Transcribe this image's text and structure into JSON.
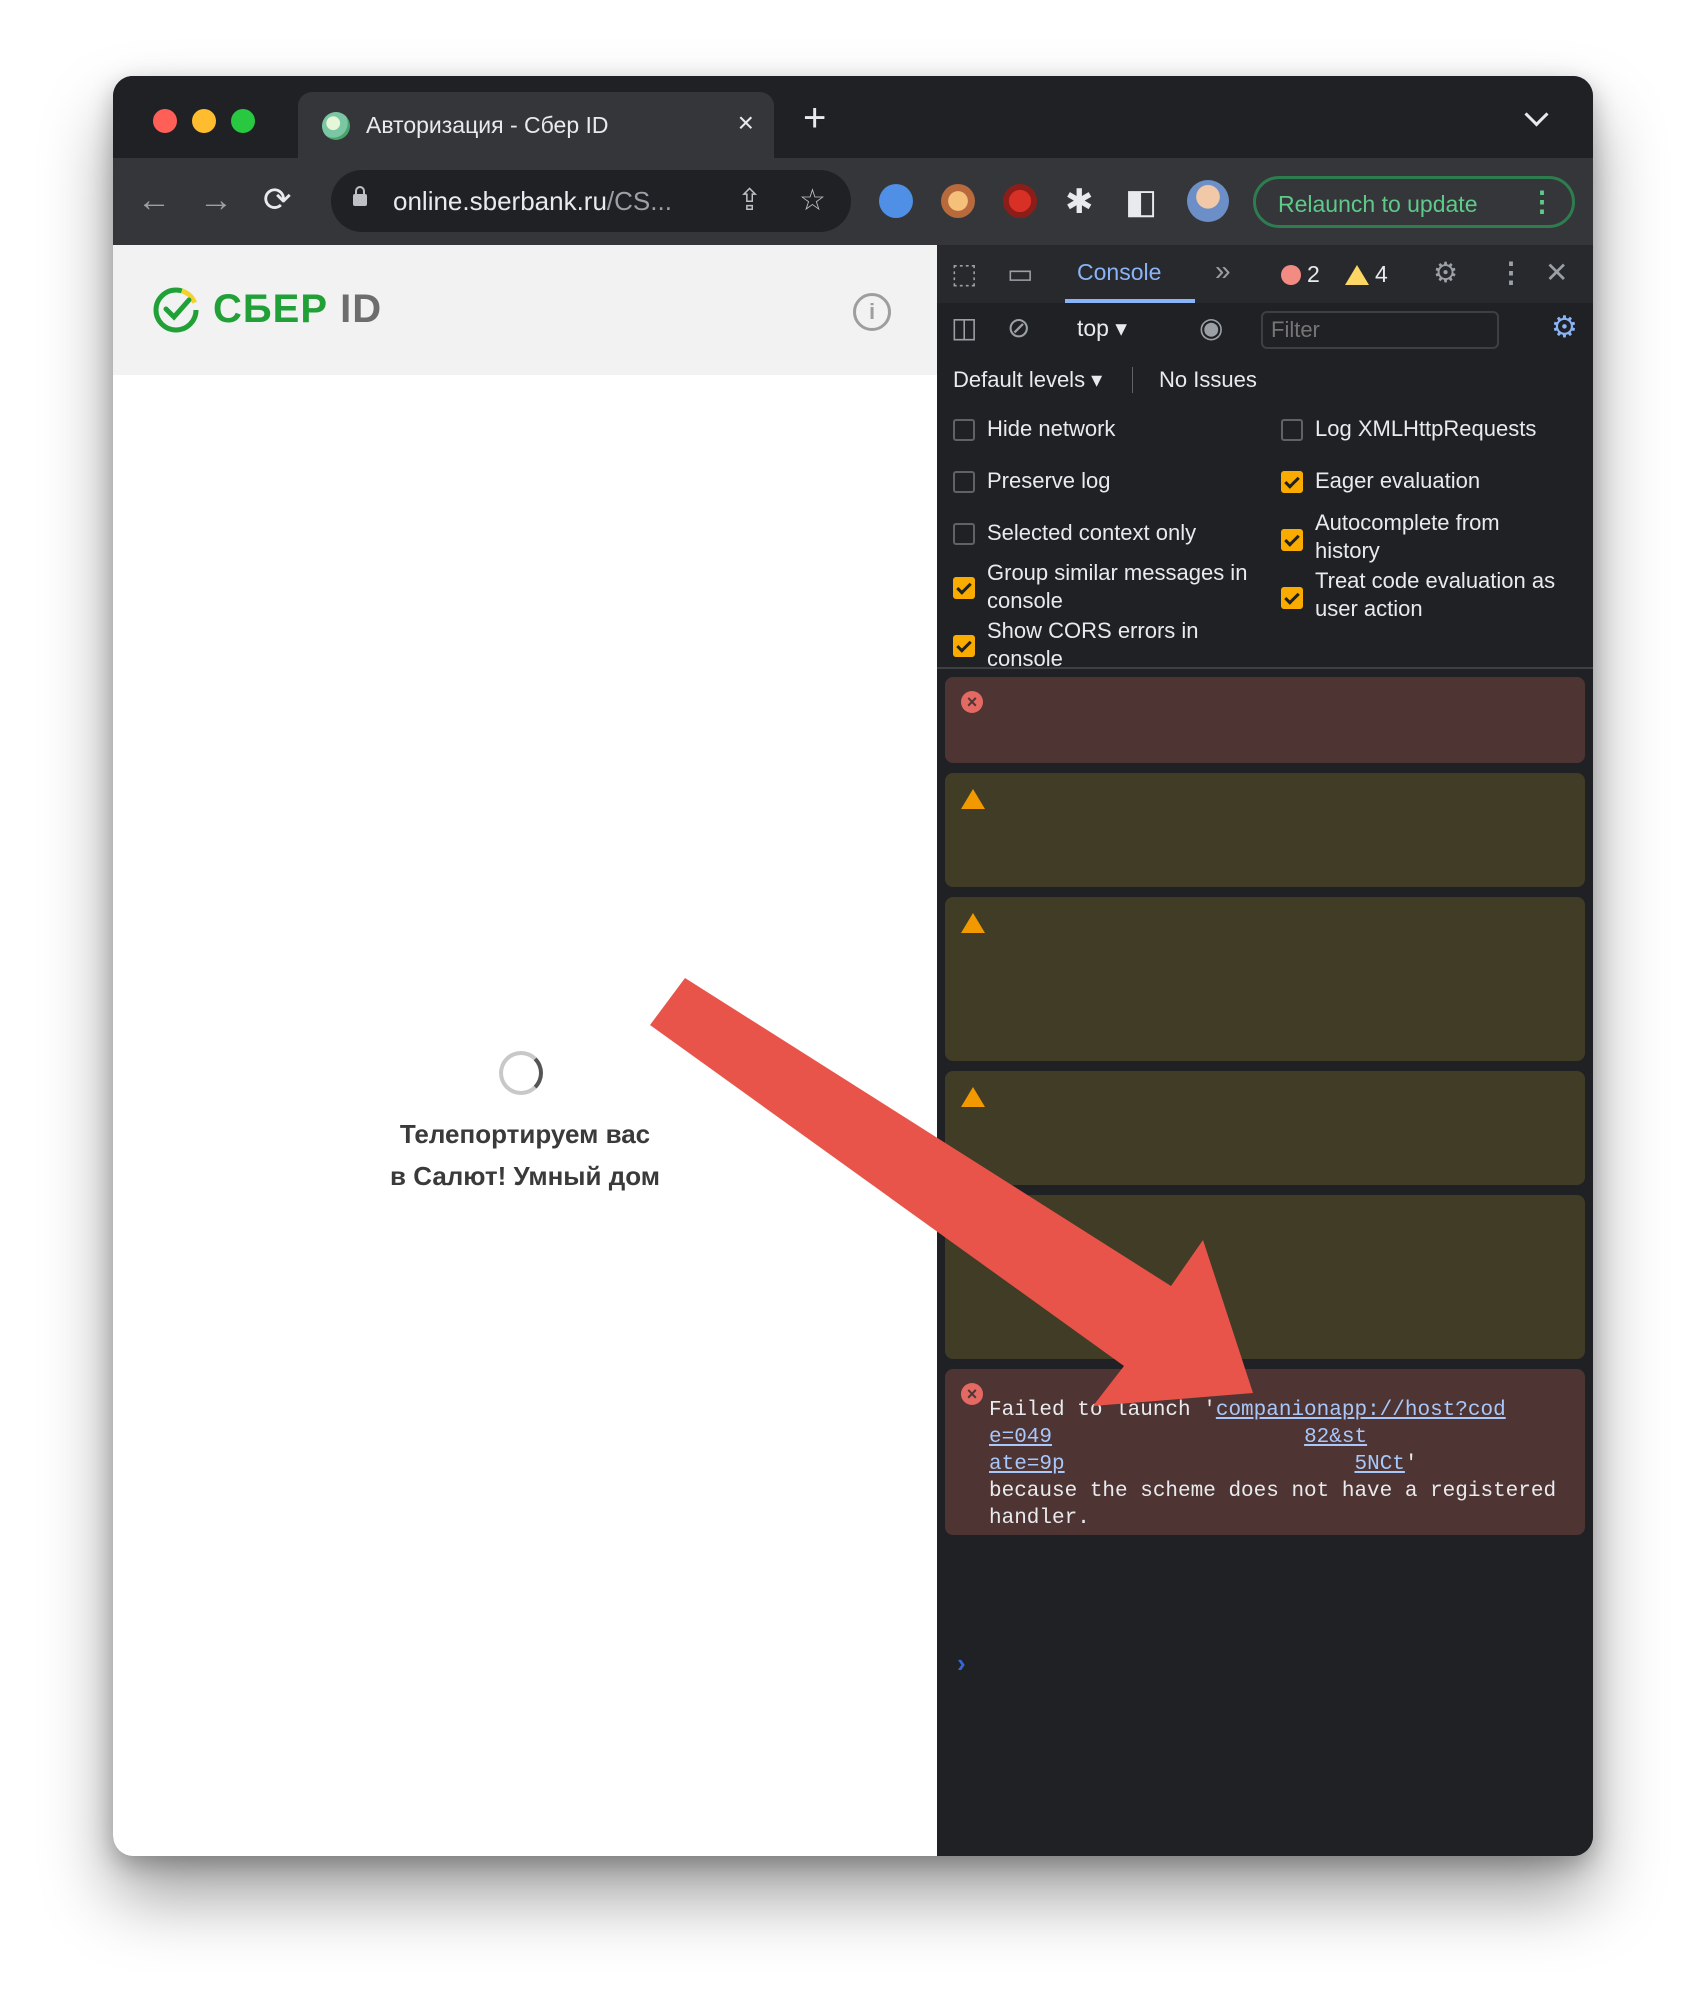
{
  "window": {
    "tab_title": "Авторизация - Сбер ID",
    "tab_close": "×",
    "new_tab": "+",
    "url_host": "online.sberbank.ru",
    "url_rest": "/CS...",
    "relaunch_label": "Relaunch to update",
    "relaunch_menu": "⋮"
  },
  "icons": {
    "back": "←",
    "forward": "→",
    "reload": "⟳",
    "share": "⇪",
    "bookmark": "☆",
    "extensions": "✱",
    "sidepanel": "◧"
  },
  "page": {
    "logo_text": "СБЕР",
    "logo_id": "ID",
    "info": "i",
    "loading_line1": "Телепортируем вас",
    "loading_line2": "в Салют! Умный дом"
  },
  "devtools": {
    "active_tab": "Console",
    "more_tabs": "»",
    "error_count": "2",
    "warning_count": "4",
    "context": "top ▾",
    "filter_placeholder": "Filter",
    "levels": "Default levels ▾",
    "issues": "No Issues",
    "settings": {
      "left": [
        {
          "label": "Hide network",
          "checked": false
        },
        {
          "label": "Preserve log",
          "checked": false
        },
        {
          "label": "Selected context only",
          "checked": false
        },
        {
          "label": "Group similar messages in console",
          "checked": true
        },
        {
          "label": "Show CORS errors in console",
          "checked": true
        }
      ],
      "right": [
        {
          "label": "Log XMLHttpRequests",
          "checked": false
        },
        {
          "label": "Eager evaluation",
          "checked": true
        },
        {
          "label": "Autocomplete from history",
          "checked": true
        },
        {
          "label": "Treat code evaluation as user action",
          "checked": true
        }
      ]
    },
    "messages": [
      {
        "level": "error",
        "text": ""
      },
      {
        "level": "warning",
        "text": ""
      },
      {
        "level": "warning",
        "text": ""
      },
      {
        "level": "warning",
        "text": ""
      },
      {
        "level": "warning",
        "text": ""
      },
      {
        "level": "error",
        "prefix": "Failed to launch '",
        "link_part1": "companionapp://host?cod",
        "link_part2": "e=049",
        "link_part3": "82&st",
        "link_part4": "ate=9p",
        "link_part5": "5NCt",
        "suffix": "'",
        "tail": "because the scheme does not have a registered handler."
      }
    ],
    "prompt": "›"
  },
  "colors": {
    "annotation_arrow": "#e8544a",
    "sber_green": "#21a038"
  }
}
